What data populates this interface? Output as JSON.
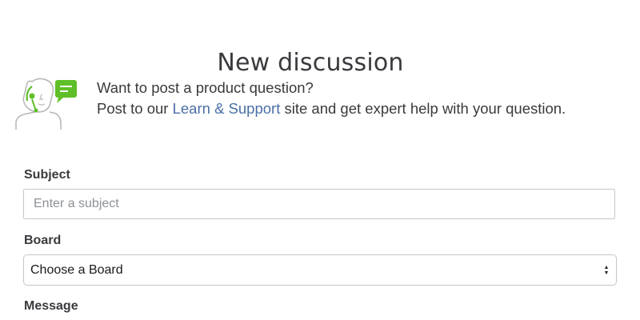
{
  "page": {
    "title": "New discussion"
  },
  "promo": {
    "question": "Want to post a product question?",
    "text_before_link": "Post to our ",
    "link_label": "Learn & Support",
    "text_after_link": " site and get expert help with your question.",
    "icon": "support-agent-chat-icon"
  },
  "form": {
    "subject": {
      "label": "Subject",
      "placeholder": "Enter a subject",
      "value": ""
    },
    "board": {
      "label": "Board",
      "selected": "Choose a Board"
    },
    "message": {
      "label": "Message"
    }
  },
  "colors": {
    "brand_green": "#5fbf28",
    "link_blue": "#4a6fa5",
    "text": "#393a3d",
    "border": "#c7c7c7"
  }
}
